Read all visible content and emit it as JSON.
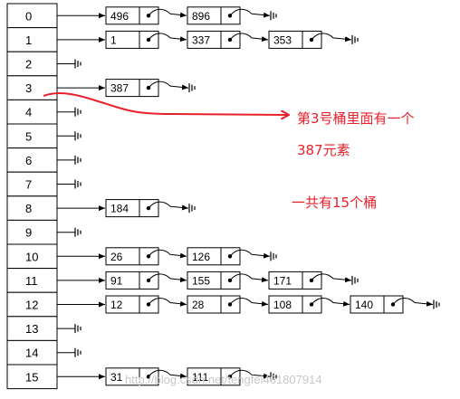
{
  "buckets": [
    {
      "index": "0",
      "items": [
        "496",
        "896"
      ]
    },
    {
      "index": "1",
      "items": [
        "1",
        "337",
        "353"
      ]
    },
    {
      "index": "2",
      "items": []
    },
    {
      "index": "3",
      "items": [
        "387"
      ]
    },
    {
      "index": "4",
      "items": []
    },
    {
      "index": "5",
      "items": []
    },
    {
      "index": "6",
      "items": []
    },
    {
      "index": "7",
      "items": []
    },
    {
      "index": "8",
      "items": [
        "184"
      ]
    },
    {
      "index": "9",
      "items": []
    },
    {
      "index": "10",
      "items": [
        "26",
        "126"
      ]
    },
    {
      "index": "11",
      "items": [
        "91",
        "155",
        "171"
      ]
    },
    {
      "index": "12",
      "items": [
        "12",
        "28",
        "108",
        "140"
      ]
    },
    {
      "index": "13",
      "items": []
    },
    {
      "index": "14",
      "items": []
    },
    {
      "index": "15",
      "items": [
        "31",
        "111"
      ]
    }
  ],
  "annotations": {
    "bucket3_line1": "第3号桶里面有一个",
    "bucket3_line2": "387元素",
    "total": "一共有15个桶"
  },
  "watermark": "http://blog.csdn.net/tengfei461807914",
  "colors": {
    "annotation": "#e8202a",
    "line": "#000000",
    "watermark": "#c8c8c8"
  }
}
